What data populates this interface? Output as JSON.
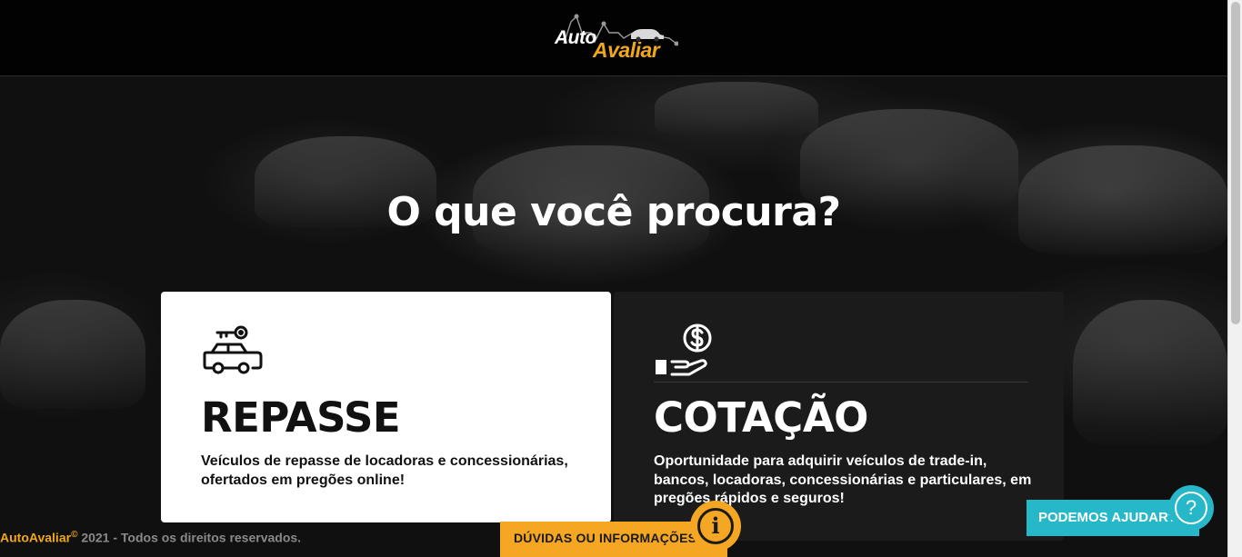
{
  "header": {
    "logo_part1": "Auto",
    "logo_part2": "Avaliar"
  },
  "main": {
    "headline": "O que você procura?"
  },
  "cards": [
    {
      "icon": "car-key-icon",
      "title": "REPASSE",
      "description": "Veículos de repasse de locadoras e concessionárias, ofertados em pregões online!"
    },
    {
      "icon": "hand-coin-icon",
      "title": "COTAÇÃO",
      "description": "Oportunidade para adquirir veículos de trade-in, bancos, locadoras, concessionárias e particulares, em pregões rápidos e seguros!"
    }
  ],
  "footer": {
    "brand": "AutoAvaliar",
    "copyright_symbol": "©",
    "copyright_text": " 2021 - Todos os direitos reservados.",
    "duvidas_label": "DÚVIDAS OU INFORMAÇÕES?",
    "info_icon": "i",
    "help_label": "PODEMOS AJUDAR?",
    "help_icon": "?"
  },
  "colors": {
    "accent_orange": "#f5a623",
    "help_teal": "#26b8c8",
    "brand_yellow": "#f0a818"
  }
}
